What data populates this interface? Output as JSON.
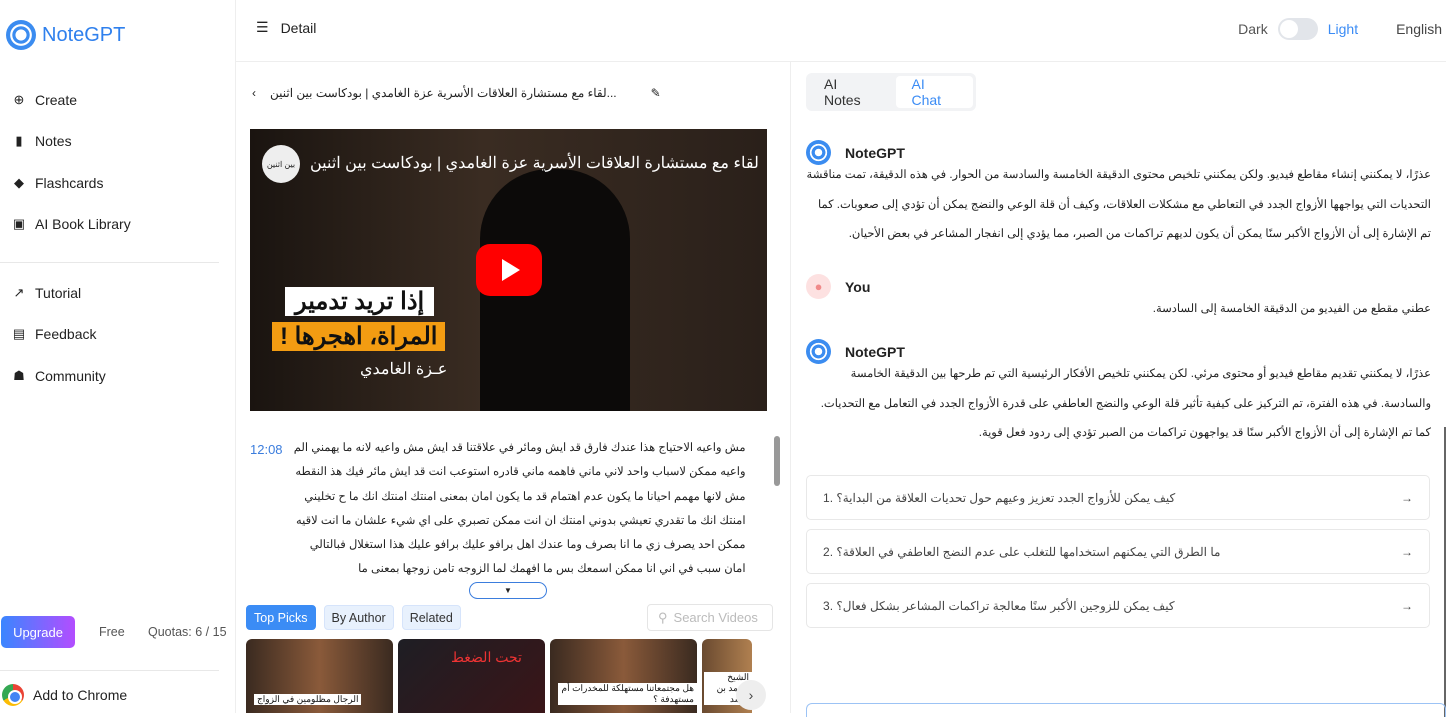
{
  "app": {
    "name": "NoteGPT"
  },
  "sidebar": {
    "items": [
      {
        "label": "Create",
        "icon": "plus-circle-icon"
      },
      {
        "label": "Notes",
        "icon": "notebook-icon"
      },
      {
        "label": "Flashcards",
        "icon": "flashcards-icon"
      },
      {
        "label": "AI Book Library",
        "icon": "book-icon"
      }
    ],
    "items2": [
      {
        "label": "Tutorial",
        "icon": "external-link-icon"
      },
      {
        "label": "Feedback",
        "icon": "document-icon"
      },
      {
        "label": "Community",
        "icon": "community-icon"
      }
    ],
    "upgrade": "Upgrade",
    "plan": "Free",
    "quota": "Quotas: 6 / 15",
    "add_chrome": "Add to Chrome"
  },
  "header": {
    "title": "Detail",
    "dark": "Dark",
    "light": "Light",
    "language": "English",
    "theme_mode": "light",
    "accent": "#3b8cf5"
  },
  "video": {
    "title": "...لقاء مع مستشارة العلاقات الأسرية عزة الغامدي | بودكاست بين اثنين",
    "overlay_title": "لقاء مع مستشارة العلاقات الأسرية عزة الغامدي | بودكاست بين اثنين",
    "channel": "بين اثنين",
    "caption1": "إذا تريد تدمير",
    "caption2": "المراة، اهجرها !",
    "caption3": "عـزة الغامدي"
  },
  "transcript": {
    "timestamp": "12:08",
    "text": "مش واعيه الاحتياج هذا عندك فارق قد ايش ومائر في علاقتنا قد ايش مش واعيه لانه ما يهمني الم واعيه ممكن لاسباب واحد لاني ماني فاهمه ماني قادره استوعب انت قد ايش مائر فيك هذ النقطه مش لانها مهمم احيانا ما يكون عدم اهتمام قد ما يكون امان بمعنى امنتك امنتك انك ما ح تخليني امنتك انك ما تقدري تعيشي بدوني امنتك ان انت ممكن تصبري على اي شيء علشان ما انت لاقيه ممكن احد يصرف زي ما انا بصرف وما عندك اهل برافو عليك برافو عليك هذا استغلال فبالتالي امان سبب في اني انا ممكن اسمعك بس ما افهمك لما الزوجه تامن زوجها بمعنى ما"
  },
  "video_tabs": [
    {
      "label": "Top Picks",
      "active": true
    },
    {
      "label": "By Author",
      "active": false
    },
    {
      "label": "Related",
      "active": false
    }
  ],
  "search": {
    "placeholder": "Search Videos"
  },
  "thumbnails": [
    {
      "caption": "الرجال مظلومين في الزواج"
    },
    {
      "caption": "تحت الضغط"
    },
    {
      "caption": "هل مجتمعاتنا مستهلكة للمخدرات أم مستهدفة ؟"
    },
    {
      "caption": "الشيخ محمد بن راشد"
    }
  ],
  "chat": {
    "tabs": [
      {
        "label": "AI Notes",
        "active": false
      },
      {
        "label": "AI Chat",
        "active": true
      }
    ],
    "messages": [
      {
        "sender": "NoteGPT",
        "text": "عذرًا، لا يمكنني إنشاء مقاطع فيديو. ولكن يمكنني تلخيص محتوى الدقيقة الخامسة والسادسة من الحوار. في هذه الدقيقة، تمت مناقشة التحديات التي يواجهها الأزواج الجدد في التعاطي مع مشكلات العلاقات، وكيف أن قلة الوعي والنضج يمكن أن تؤدي إلى صعوبات. كما تم الإشارة إلى أن الأزواج الأكبر سنًا يمكن أن يكون لديهم تراكمات من الصبر، مما يؤدي إلى انفجار المشاعر في بعض الأحيان."
      },
      {
        "sender": "You",
        "text": "عطني مقطع من الفيديو من الدقيقة الخامسة إلى السادسة."
      },
      {
        "sender": "NoteGPT",
        "text": "عذرًا، لا يمكنني تقديم مقاطع فيديو أو محتوى مرئي. لكن يمكنني تلخيص الأفكار الرئيسية التي تم طرحها بين الدقيقة الخامسة والسادسة. في هذه الفترة، تم التركيز على كيفية تأثير قلة الوعي والنضج العاطفي على قدرة الأزواج الجدد في التعامل مع التحديات. كما تم الإشارة إلى أن الأزواج الأكبر سنًا قد يواجهون تراكمات من الصبر تؤدي إلى ردود فعل قوية."
      }
    ],
    "suggestions": [
      "كيف يمكن للأزواج الجدد تعزيز وعيهم حول تحديات العلاقة من البداية؟ .1",
      "ما الطرق التي يمكنهم استخدامها للتغلب على عدم النضج العاطفي في العلاقة؟ .2",
      "كيف يمكن للزوجين الأكبر سنًا معالجة تراكمات المشاعر بشكل فعال؟ .3"
    ]
  }
}
